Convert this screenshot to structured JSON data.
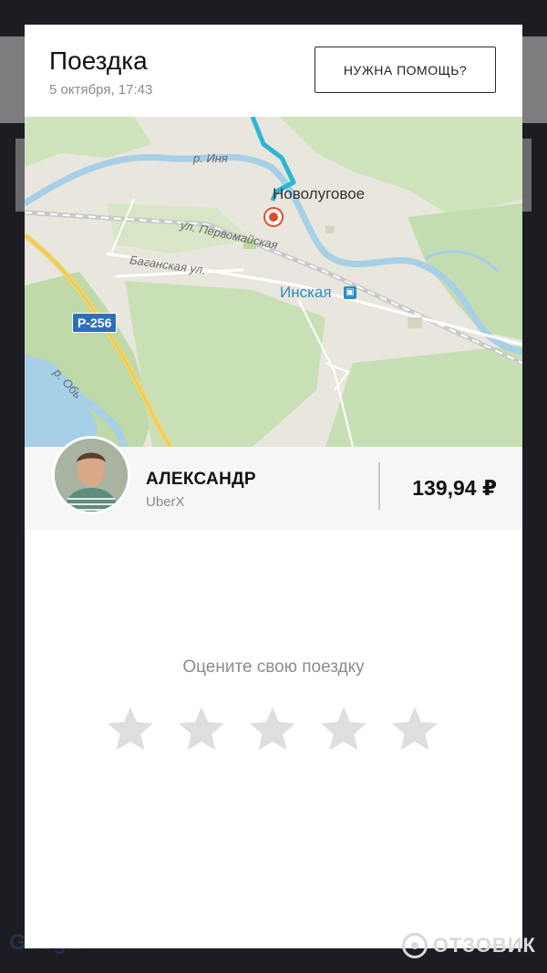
{
  "header": {
    "title": "Поездка",
    "date": "5 октября, 17:43",
    "help_button": "НУЖНА ПОМОЩЬ?"
  },
  "map": {
    "river_label": "р. Иня",
    "town": "Новолуговое",
    "street_1": "ул. Первомайская",
    "street_2": "Баганская ул.",
    "station": "Инская",
    "road_shield": "Р-256",
    "river_ob": "р. Обь"
  },
  "driver": {
    "name": "АЛЕКСАНДР",
    "product": "UberX",
    "price": "139,94 ₽"
  },
  "rating": {
    "prompt": "Оцените свою поездку",
    "stars_selected": 0,
    "stars_total": 5
  },
  "watermark": "ОТЗОВИК",
  "colors": {
    "route": "#2cb6d6",
    "pin": "#e6462d",
    "station": "#2a8fbf",
    "star_empty": "#dedede"
  },
  "icons": {
    "station": "train-station-icon",
    "pin": "destination-pin-icon",
    "star": "star-icon"
  }
}
